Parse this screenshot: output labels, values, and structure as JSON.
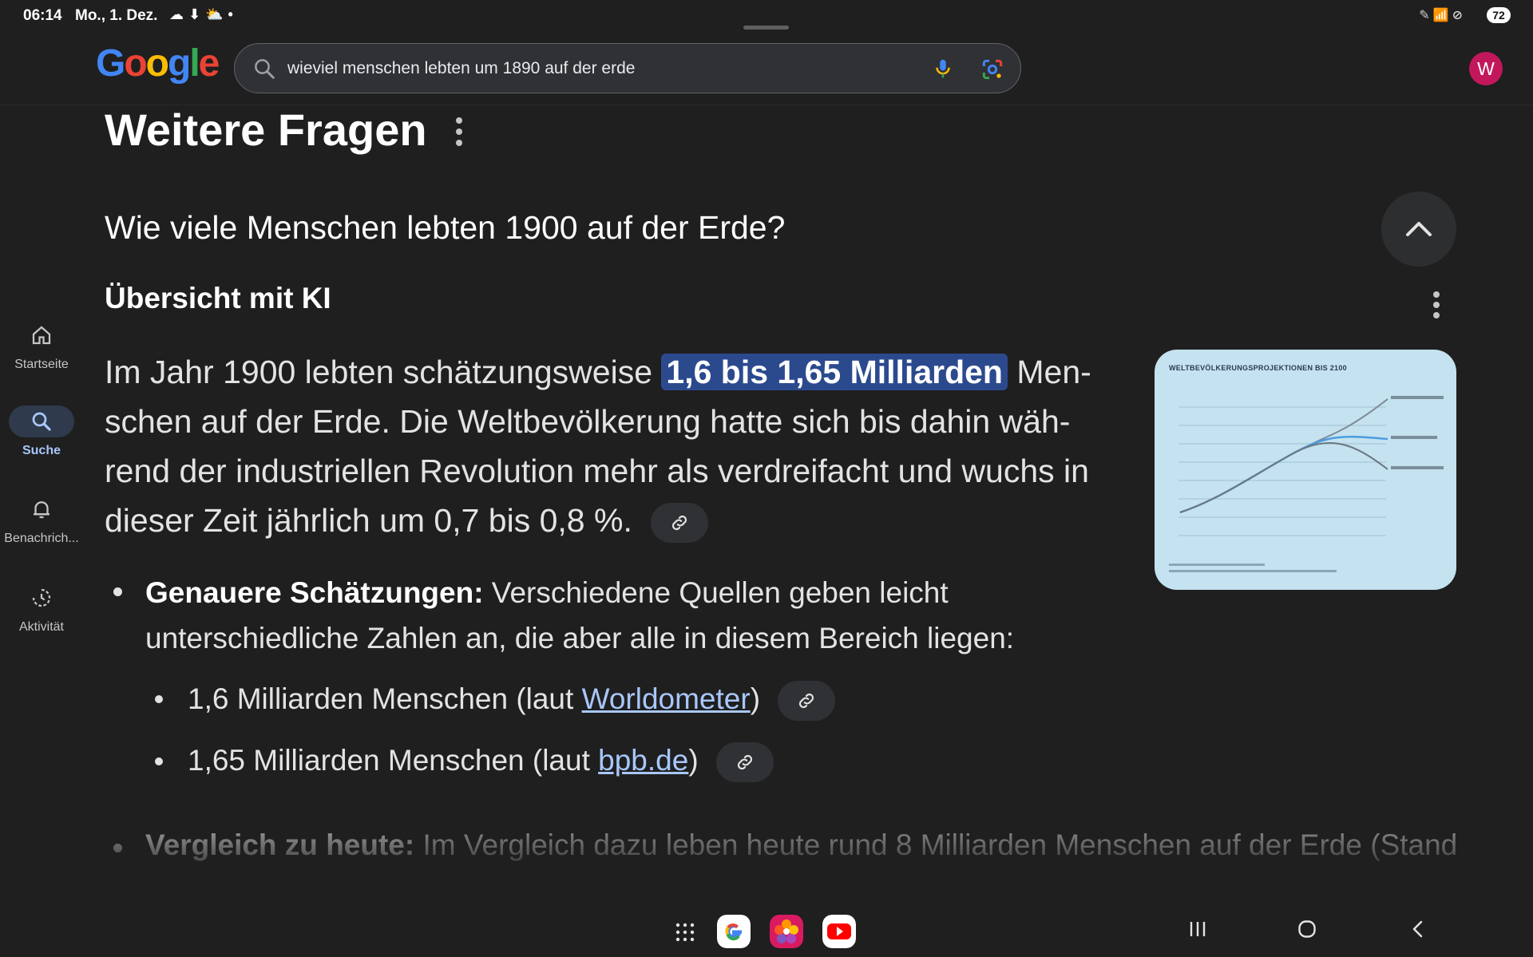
{
  "status_bar": {
    "time": "06:14",
    "date": "Mo., 1. Dez.",
    "left_icons": [
      "cloud-icon",
      "download-icon",
      "cloud-sun-icon",
      "dot-icon"
    ],
    "right_icons": [
      "pen-icon",
      "wifi-icon",
      "dnd-icon"
    ],
    "battery": "72"
  },
  "header": {
    "logo_letters": [
      "G",
      "o",
      "o",
      "g",
      "l",
      "e"
    ],
    "search_query": "wieviel menschen lebten um 1890 auf der erde",
    "avatar_letter": "W"
  },
  "sidebar": {
    "items": [
      {
        "label": "Startseite",
        "icon": "home-icon",
        "active": false
      },
      {
        "label": "Suche",
        "icon": "search-icon",
        "active": true
      },
      {
        "label": "Benachrich...",
        "icon": "bell-icon",
        "active": false
      },
      {
        "label": "Aktivität",
        "icon": "activity-icon",
        "active": false
      }
    ]
  },
  "main": {
    "section_title": "Weitere Fragen",
    "question": "Wie viele Menschen lebten 1900 auf der Erde?",
    "ai_heading": "Übersicht mit KI",
    "answer_prefix": "Im Jahr 1900 lebten schätzungsweise ",
    "answer_highlight": "1,6 bis 1,65 Milliarden",
    "answer_suffix": " Men-schen auf der Erde. Die Weltbevölkerung hatte sich bis dahin wäh-rend der industriellen Revolution mehr als verdreifacht und wuchs in dieser Zeit jährlich um 0,7 bis 0,8 %.",
    "thumbnail_title": "WELTBEVÖLKERUNGSPROJEKTIONEN BIS 2100",
    "bullet_1_bold": "Genauere Schätzungen:",
    "bullet_1_text": " Verschiedene Quellen geben leicht unterschiedliche Zahlen an, die aber alle in diesem Bereich liegen:",
    "sub_bullet_1_text": "1,6 Milliarden Menschen (laut ",
    "sub_bullet_1_link": "Worldometer",
    "sub_bullet_1_end": ")",
    "sub_bullet_2_text": "1,65 Milliarden Menschen (laut ",
    "sub_bullet_2_link": "bpb.de",
    "sub_bullet_2_end": ")",
    "bullet_3_bold": "Vergleich zu heute:",
    "bullet_3_text": " Im Vergleich dazu leben heute rund 8 Milliarden Menschen auf der Erde (Stand"
  },
  "taskbar": {
    "apps": [
      "app-drawer-icon",
      "google-app-icon",
      "gallery-app-icon",
      "youtube-app-icon"
    ],
    "nav": [
      "recents-icon",
      "home-nav-icon",
      "back-icon"
    ]
  },
  "colors": {
    "background": "#1f1f1f",
    "highlight": "#2b4a8e",
    "link": "#a8c7fa",
    "avatar": "#c2185b"
  }
}
